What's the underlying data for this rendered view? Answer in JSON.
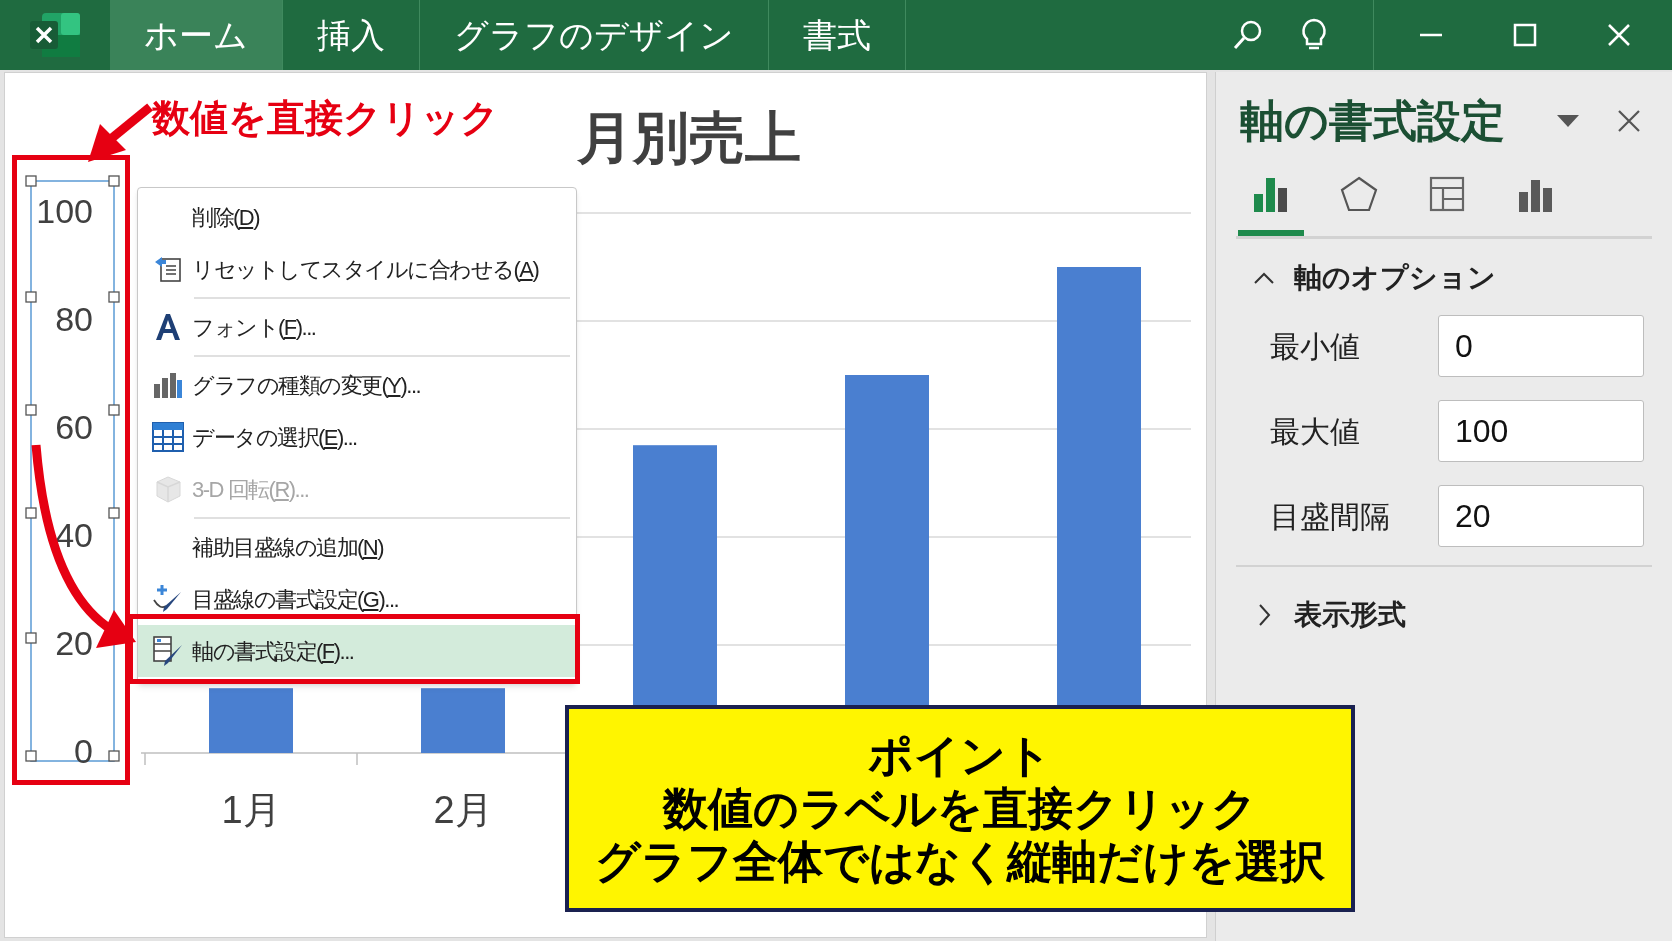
{
  "ribbon": {
    "tabs": [
      {
        "label": "ホーム",
        "selected": true
      },
      {
        "label": "挿入",
        "selected": false
      },
      {
        "label": "グラフのデザイン",
        "selected": false
      },
      {
        "label": "書式",
        "selected": false
      }
    ]
  },
  "chart": {
    "chart_data": {
      "type": "bar",
      "title": "月別売上",
      "categories": [
        "1月",
        "2月",
        null,
        null,
        null
      ],
      "series": [
        {
          "color": "#4a7fd0",
          "values": [
            12,
            12,
            57,
            70,
            90
          ]
        }
      ],
      "grid": true,
      "ylim": [
        0,
        100
      ],
      "yticks": [
        0,
        20,
        40,
        60,
        80,
        100
      ]
    },
    "axis_selected": true
  },
  "callout": "数値を直接クリック",
  "context_menu": {
    "items": [
      {
        "kind": "item",
        "before": "削除(",
        "key": "D",
        "after": ")",
        "disabled": false,
        "selected": false
      },
      {
        "kind": "item",
        "before": "リセットしてスタイルに合わせる(",
        "key": "A",
        "after": ")",
        "disabled": false,
        "selected": false
      },
      {
        "kind": "separator"
      },
      {
        "kind": "item",
        "before": "フォント(",
        "key": "F",
        "after": ")...",
        "disabled": false,
        "selected": false
      },
      {
        "kind": "separator"
      },
      {
        "kind": "item",
        "before": "グラフの種類の変更(",
        "key": "Y",
        "after": ")...",
        "disabled": false,
        "selected": false
      },
      {
        "kind": "item",
        "before": "データの選択(",
        "key": "E",
        "after": ")...",
        "disabled": false,
        "selected": false
      },
      {
        "kind": "item",
        "before": "3-D 回転(",
        "key": "R",
        "after": ")...",
        "disabled": true,
        "selected": false
      },
      {
        "kind": "separator"
      },
      {
        "kind": "item",
        "before": "補助目盛線の追加(",
        "key": "N",
        "after": ")",
        "disabled": false,
        "selected": false
      },
      {
        "kind": "item",
        "before": "目盛線の書式設定(",
        "key": "G",
        "after": ")...",
        "disabled": false,
        "selected": false
      },
      {
        "kind": "item",
        "before": "軸の書式設定(",
        "key": "F",
        "after": ")...",
        "disabled": false,
        "selected": true
      }
    ]
  },
  "note": {
    "title": "ポイント",
    "lines": [
      "数値のラベルを直接クリック",
      "グラフ全体ではなく縦軸だけを選択"
    ]
  },
  "pane": {
    "title": "軸の書式設定",
    "tabs": [
      {
        "selected": true
      },
      {
        "selected": false
      },
      {
        "selected": false
      },
      {
        "selected": false
      }
    ],
    "sections": [
      {
        "title": "軸のオプション",
        "expanded": true,
        "fields": [
          {
            "label": "最小値",
            "value": "0"
          },
          {
            "label": "最大値",
            "value": "100"
          },
          {
            "label": "目盛間隔",
            "value": "20"
          }
        ]
      },
      {
        "title": "表示形式",
        "expanded": false
      }
    ]
  }
}
